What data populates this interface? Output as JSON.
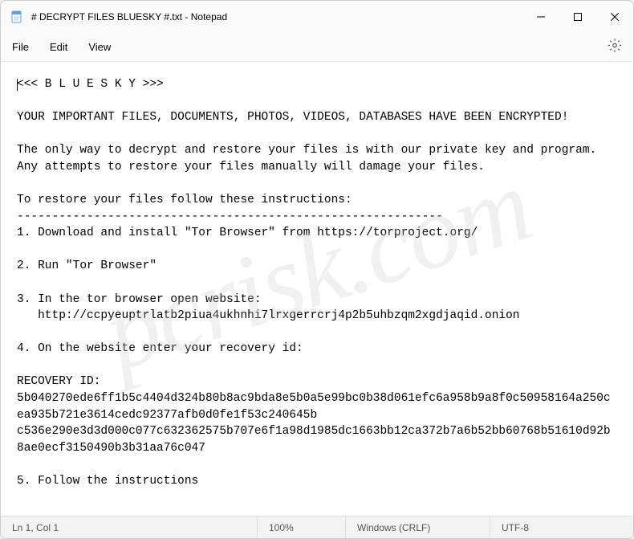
{
  "window": {
    "title": "# DECRYPT FILES BLUESKY #.txt - Notepad"
  },
  "menu": {
    "file": "File",
    "edit": "Edit",
    "view": "View"
  },
  "document": {
    "text": "<<< B L U E S K Y >>>\n\nYOUR IMPORTANT FILES, DOCUMENTS, PHOTOS, VIDEOS, DATABASES HAVE BEEN ENCRYPTED!\n\nThe only way to decrypt and restore your files is with our private key and program.\nAny attempts to restore your files manually will damage your files.\n\nTo restore your files follow these instructions:\n-------------------------------------------------------------\n1. Download and install \"Tor Browser\" from https://torproject.org/\n\n2. Run \"Tor Browser\"\n\n3. In the tor browser open website:\n   http://ccpyeuptrlatb2piua4ukhnhi7lrxgerrcrj4p2b5uhbzqm2xgdjaqid.onion\n\n4. On the website enter your recovery id:\n\nRECOVERY ID: 5b040270ede6ff1b5c4404d324b80b8ac9bda8e5b0a5e99bc0b38d061efc6a958b9a8f0c50958164a250cea935b721e3614cedc92377afb0d0fe1f53c240645b c536e290e3d3d000c077c632362575b707e6f1a98d1985dc1663bb12ca372b7a6b52bb60768b51610d92b8ae0ecf3150490b3b31aa76c047\n\n5. Follow the instructions"
  },
  "statusbar": {
    "position": "Ln 1, Col 1",
    "zoom": "100%",
    "line_ending": "Windows (CRLF)",
    "encoding": "UTF-8"
  },
  "watermark": "pcrisk.com"
}
